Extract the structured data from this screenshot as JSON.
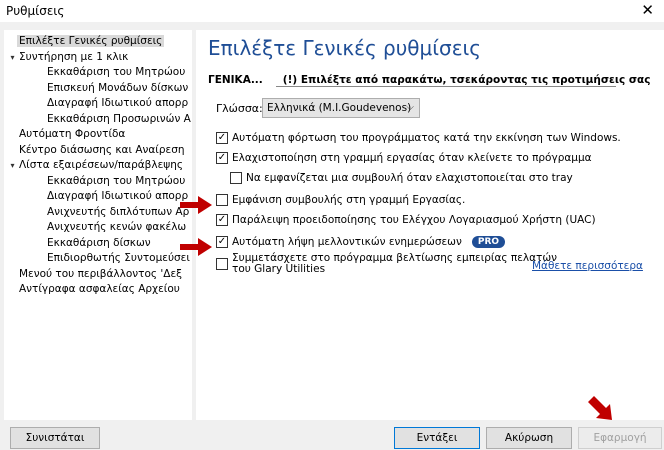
{
  "window": {
    "title": "Ρυθμίσεις",
    "close_glyph": "✕"
  },
  "tree": {
    "items": [
      {
        "label": "Επιλέξτε Γενικές ρυθμίσεις",
        "level": 0,
        "toggle": "",
        "selected": true
      },
      {
        "label": "Συντήρηση με 1 κλικ",
        "level": 0,
        "toggle": "▾"
      },
      {
        "label": "Εκκαθάριση του Μητρώου",
        "level": 2,
        "toggle": ""
      },
      {
        "label": "Επισκευή Μονάδων δίσκων",
        "level": 2,
        "toggle": ""
      },
      {
        "label": "Διαγραφή Ιδιωτικού απορρ",
        "level": 2,
        "toggle": ""
      },
      {
        "label": "Εκκαθάριση Προσωρινών Α",
        "level": 2,
        "toggle": ""
      },
      {
        "label": "Αυτόματη Φροντίδα",
        "level": 0,
        "toggle": ""
      },
      {
        "label": "Κέντρο διάσωσης και Αναίρεση",
        "level": 0,
        "toggle": ""
      },
      {
        "label": "Λίστα εξαιρέσεων/παράβλεψης",
        "level": 0,
        "toggle": "▾"
      },
      {
        "label": "Εκκαθάριση του Μητρώου",
        "level": 2,
        "toggle": ""
      },
      {
        "label": "Διαγραφή Ιδιωτικού απορρ",
        "level": 2,
        "toggle": ""
      },
      {
        "label": "Ανιχνευτής διπλότυπων Αρ",
        "level": 2,
        "toggle": ""
      },
      {
        "label": "Ανιχνευτής κενών φακέλω",
        "level": 2,
        "toggle": ""
      },
      {
        "label": "Εκκαθάριση δίσκων",
        "level": 2,
        "toggle": ""
      },
      {
        "label": "Επιδιορθωτής Συντομεύσει",
        "level": 2,
        "toggle": ""
      },
      {
        "label": "Μενού του περιβάλλοντος 'Δεξ",
        "level": 0,
        "toggle": ""
      },
      {
        "label": "Αντίγραφα ασφαλείας Αρχείου",
        "level": 0,
        "toggle": ""
      }
    ]
  },
  "content": {
    "heading": "Επιλέξτε Γενικές ρυθμίσεις",
    "section": "ΓΕΝΙΚΑ...",
    "instruction": "(!) Επιλέξτε από παρακάτω, τσεκάροντας τις προτιμήσεις σας",
    "language_label": "Γλώσσα:",
    "language_value": "Ελληνικά (M.I.Goudevenos)",
    "options": [
      {
        "label": "Αυτόματη φόρτωση του προγράμματος κατά την εκκίνηση των Windows.",
        "checked": true,
        "indent": 0
      },
      {
        "label": "Ελαχιστοποίηση στη γραμμή εργασίας όταν κλείνετε το πρόγραμμα",
        "checked": true,
        "indent": 0
      },
      {
        "label": "Να εμφανίζεται μια συμβουλή όταν ελαχιστοποιείται στο tray",
        "checked": false,
        "indent": 1
      },
      {
        "label": "Εμφάνιση συμβουλής στη γραμμή Εργασίας.",
        "checked": false,
        "indent": 0
      },
      {
        "label": "Παράλειψη προειδοποίησης του Ελέγχου Λογαριασμού Χρήστη (UAC)",
        "checked": true,
        "indent": 0
      },
      {
        "label": "Αυτόματη λήψη μελλοντικών ενημερώσεων",
        "checked": true,
        "indent": 0,
        "badge": "PRO"
      },
      {
        "label": "Συμμετάσχετε στο πρόγραμμα βελτίωσης εμπειρίας πελατών",
        "label2": "του Glary Utilities",
        "checked": false,
        "indent": 0
      }
    ],
    "learn_more": "Μάθετε περισσότερα",
    "check_glyph": "✓"
  },
  "buttons": {
    "recommend": "Συνιστάται",
    "ok": "Εντάξει",
    "cancel": "Ακύρωση",
    "apply": "Εφαρμογή"
  },
  "colors": {
    "accent": "#1f4e96",
    "arrow": "#c00000",
    "link": "#1a4fa8"
  }
}
